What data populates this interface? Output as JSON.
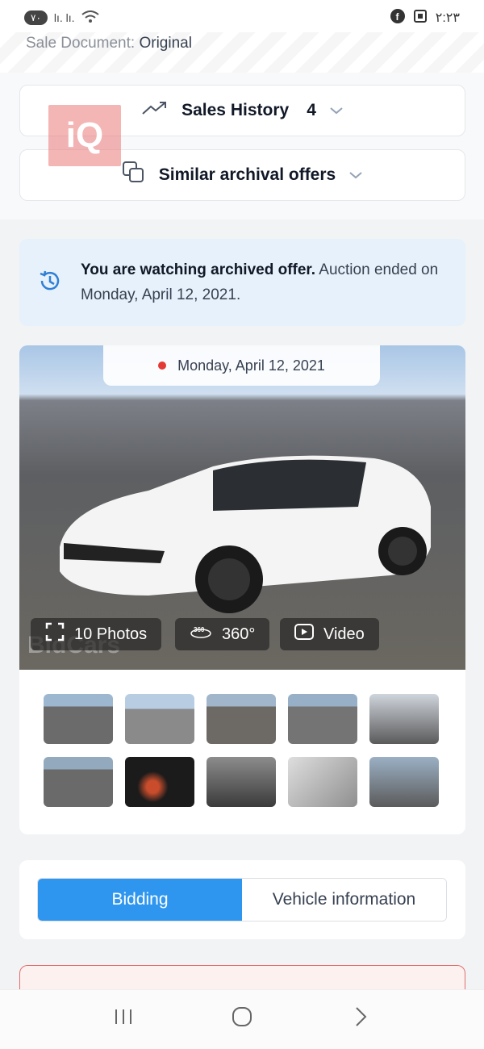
{
  "status_bar": {
    "badge": "٧٠",
    "signal": "lı. lı.",
    "time": "٢:٢٣"
  },
  "sale_document": {
    "label": "Sale Document:",
    "value": "Original"
  },
  "sales_history": {
    "label": "Sales History",
    "count": "4"
  },
  "similar_offers": {
    "label": "Similar archival offers"
  },
  "logo_text": "iQ",
  "notice": {
    "bold": "You are watching archived offer.",
    "rest": " Auction ended on Monday, April 12, 2021."
  },
  "photo": {
    "date": "Monday, April 12, 2021",
    "photos_label": "10 Photos",
    "label_360": "360°",
    "video_label": "Video",
    "watermark": "BidCars"
  },
  "tabs": {
    "bidding": "Bidding",
    "vehicle_info": "Vehicle information"
  },
  "colors": {
    "accent": "#2f96f0",
    "notice_bg": "#e6f1fb",
    "alert_border": "#e06d6d"
  }
}
